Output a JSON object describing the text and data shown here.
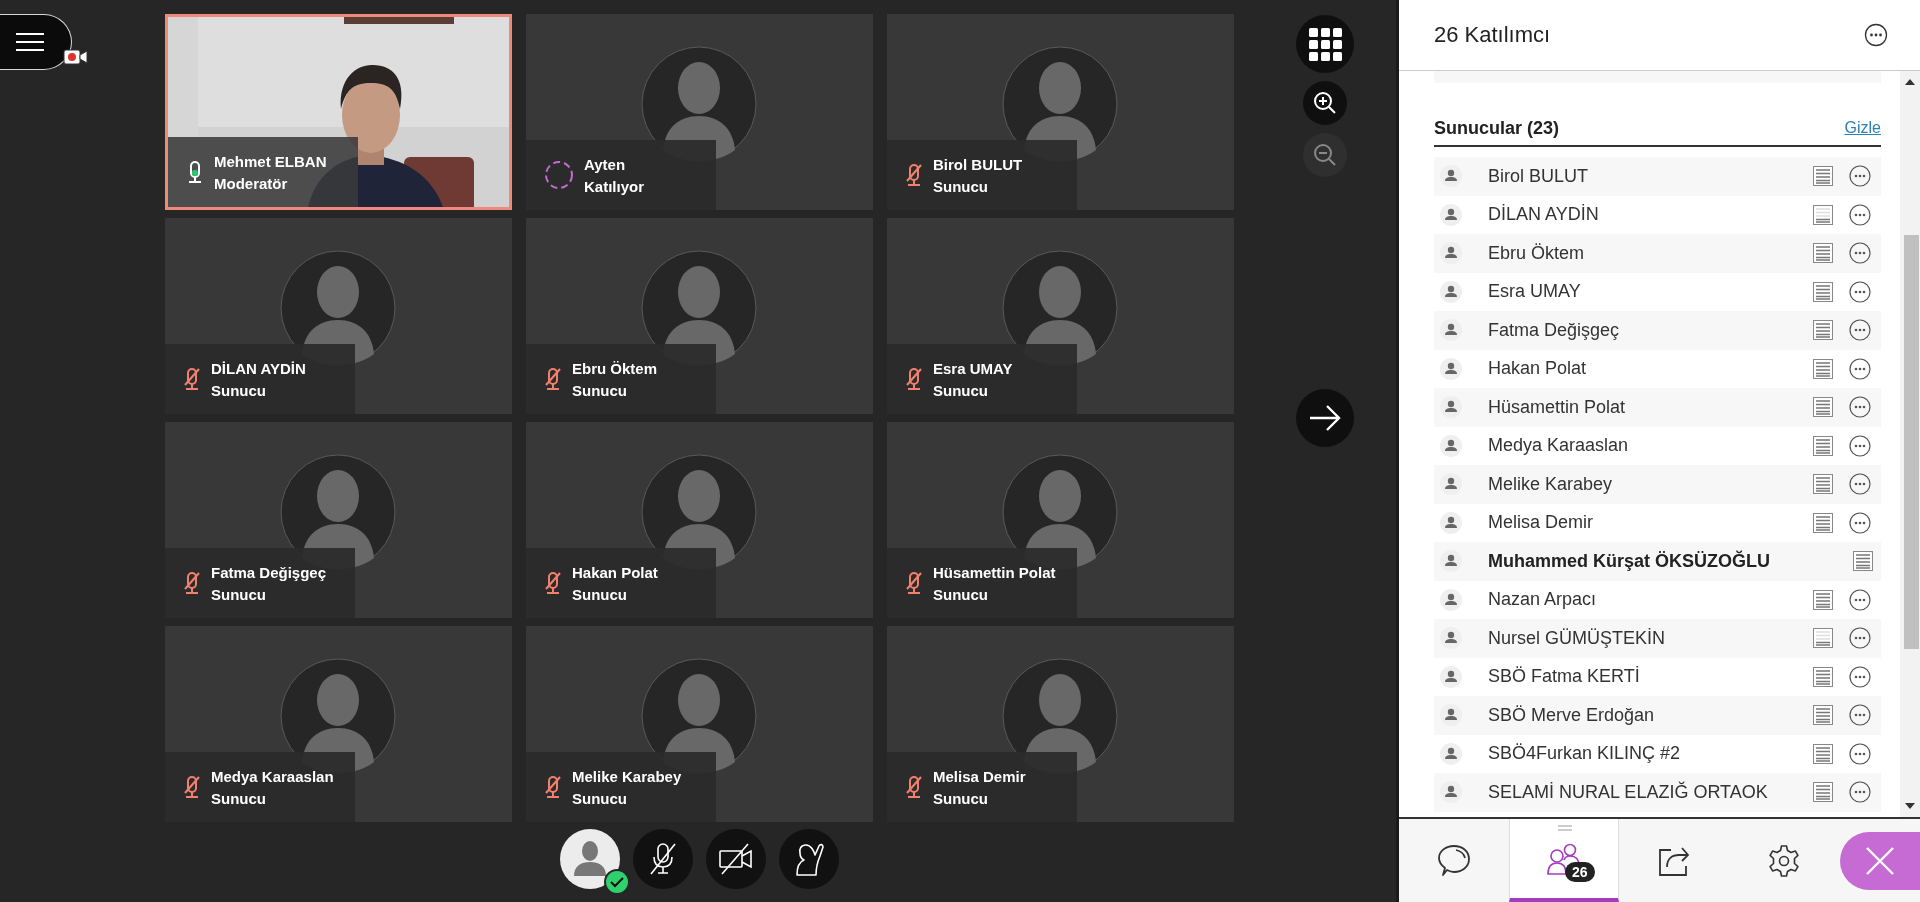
{
  "menu": {
    "recording": true
  },
  "tiles": [
    {
      "name": "Mehmet ELBAN",
      "role": "Moderatör",
      "joining": false,
      "muted": false,
      "kind": "video",
      "active": true
    },
    {
      "name": "Ayten",
      "role": "Katılıyor",
      "joining": true,
      "kind": "avatar",
      "active": false
    },
    {
      "name": "Birol BULUT",
      "role": "Sunucu",
      "joining": false,
      "muted": true,
      "kind": "avatar",
      "active": false
    },
    {
      "name": "DİLAN AYDİN",
      "role": "Sunucu",
      "joining": false,
      "muted": true,
      "kind": "avatar",
      "active": false
    },
    {
      "name": "Ebru Öktem",
      "role": "Sunucu",
      "joining": false,
      "muted": true,
      "kind": "avatar",
      "active": false
    },
    {
      "name": "Esra UMAY",
      "role": "Sunucu",
      "joining": false,
      "muted": true,
      "kind": "avatar",
      "active": false
    },
    {
      "name": "Fatma Değişgeç",
      "role": "Sunucu",
      "joining": false,
      "muted": true,
      "kind": "avatar",
      "active": false
    },
    {
      "name": "Hakan Polat",
      "role": "Sunucu",
      "joining": false,
      "muted": true,
      "kind": "avatar",
      "active": false
    },
    {
      "name": "Hüsamettin Polat",
      "role": "Sunucu",
      "joining": false,
      "muted": true,
      "kind": "avatar",
      "active": false
    },
    {
      "name": "Medya Karaaslan",
      "role": "Sunucu",
      "joining": false,
      "muted": true,
      "kind": "avatar",
      "active": false
    },
    {
      "name": "Melike Karabey",
      "role": "Sunucu",
      "joining": false,
      "muted": true,
      "kind": "avatar",
      "active": false
    },
    {
      "name": "Melisa Demir",
      "role": "Sunucu",
      "joining": false,
      "muted": true,
      "kind": "avatar",
      "active": false
    }
  ],
  "view_controls": {
    "zoom_in": {
      "disabled": false
    },
    "zoom_out": {
      "disabled": true
    }
  },
  "my_controls": {
    "status_ok": true,
    "mic_muted": true,
    "camera_off": true
  },
  "panel": {
    "title": "26 Katılımcı",
    "section": {
      "title": "Sunucular (23)",
      "hide_link": "Gizle"
    },
    "rows": [
      {
        "name": "Birol BULUT",
        "bold": false,
        "list_faded": false,
        "more_button": true
      },
      {
        "name": "DİLAN AYDİN",
        "bold": false,
        "list_faded": true,
        "more_button": true
      },
      {
        "name": "Ebru Öktem",
        "bold": false,
        "list_faded": false,
        "more_button": true
      },
      {
        "name": "Esra UMAY",
        "bold": false,
        "list_faded": false,
        "more_button": true
      },
      {
        "name": "Fatma Değişgeç",
        "bold": false,
        "list_faded": false,
        "more_button": true
      },
      {
        "name": "Hakan Polat",
        "bold": false,
        "list_faded": false,
        "more_button": true
      },
      {
        "name": "Hüsamettin Polat",
        "bold": false,
        "list_faded": false,
        "more_button": true
      },
      {
        "name": "Medya Karaaslan",
        "bold": false,
        "list_faded": false,
        "more_button": true
      },
      {
        "name": "Melike Karabey",
        "bold": false,
        "list_faded": false,
        "more_button": true
      },
      {
        "name": "Melisa Demir",
        "bold": false,
        "list_faded": false,
        "more_button": true
      },
      {
        "name": "Muhammed Kürşat ÖKSÜZOĞLU",
        "bold": true,
        "list_faded": false,
        "more_button": false
      },
      {
        "name": "Nazan Arpacı",
        "bold": false,
        "list_faded": false,
        "more_button": true
      },
      {
        "name": "Nursel GÜMÜŞTEKİN",
        "bold": false,
        "list_faded": true,
        "more_button": true
      },
      {
        "name": "SBÖ Fatma KERTİ",
        "bold": false,
        "list_faded": false,
        "more_button": true
      },
      {
        "name": "SBÖ Merve Erdoğan",
        "bold": false,
        "list_faded": false,
        "more_button": true
      },
      {
        "name": "SBÖ4Furkan KILINÇ #2",
        "bold": false,
        "list_faded": false,
        "more_button": true
      },
      {
        "name": "SELAMİ NURAL ELAZIĞ ORTAOK",
        "bold": false,
        "list_faded": false,
        "more_button": true
      }
    ]
  },
  "tabs": [
    {
      "kind": "chat",
      "selected": false
    },
    {
      "kind": "participants",
      "selected": true,
      "badge": "26"
    },
    {
      "kind": "share",
      "selected": false
    },
    {
      "kind": "settings",
      "selected": false
    }
  ]
}
